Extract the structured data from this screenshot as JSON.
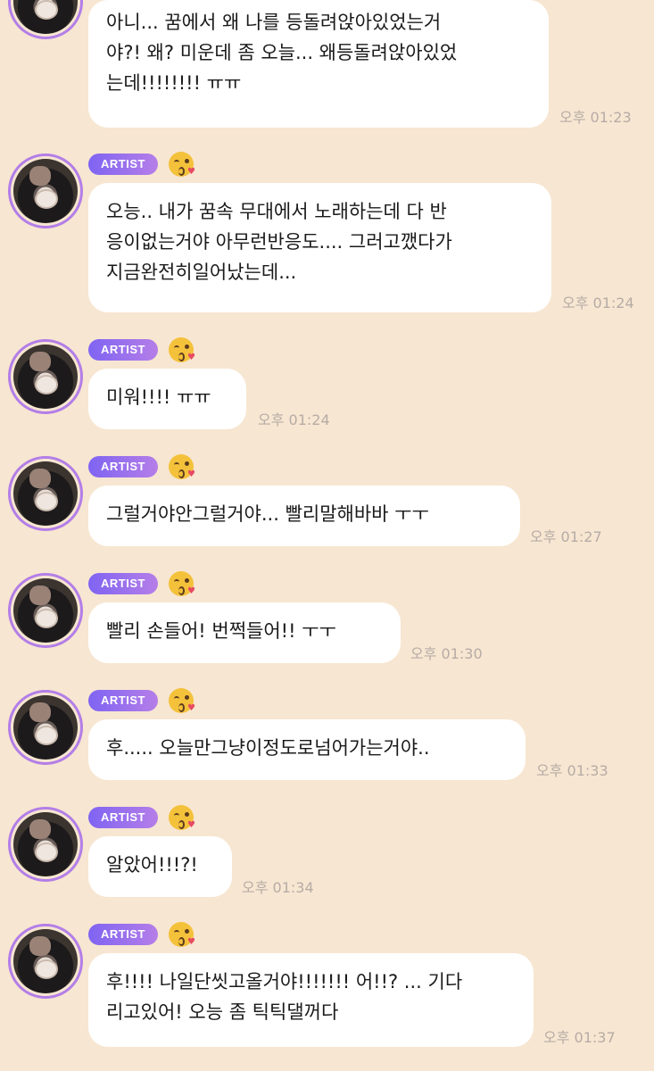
{
  "chat": {
    "messages": [
      {
        "show_header": false,
        "text": "아니... 꿈에서 왜 나를 등돌려앉아있었는거\n야?! 왜? 미운데 좀 오늘... 왜등돌려앉아있었\n는데!!!!!!!! ㅠㅠ",
        "time": "오후 01:23"
      },
      {
        "show_header": true,
        "badge": "ARTIST",
        "emoji": "kissing-heart-emoji",
        "text": "오능.. 내가 꿈속 무대에서 노래하는데 다 반\n응이없는거야 아무런반응도.... 그러고깼다가\n지금완전히일어났는데...",
        "time": "오후 01:24"
      },
      {
        "show_header": true,
        "badge": "ARTIST",
        "emoji": "kissing-heart-emoji",
        "text": "미워!!!! ㅠㅠ",
        "time": "오후 01:24"
      },
      {
        "show_header": true,
        "badge": "ARTIST",
        "emoji": "kissing-heart-emoji",
        "text": "그럴거야안그럴거야... 빨리말해바바 ㅜㅜ",
        "time": "오후 01:27"
      },
      {
        "show_header": true,
        "badge": "ARTIST",
        "emoji": "kissing-heart-emoji",
        "text": "빨리 손들어! 번쩍들어!! ㅜㅜ",
        "time": "오후 01:30"
      },
      {
        "show_header": true,
        "badge": "ARTIST",
        "emoji": "kissing-heart-emoji",
        "text": "후..... 오늘만그냥이정도로넘어가는거야..",
        "time": "오후 01:33"
      },
      {
        "show_header": true,
        "badge": "ARTIST",
        "emoji": "kissing-heart-emoji",
        "text": "알았어!!!?!",
        "time": "오후 01:34"
      },
      {
        "show_header": true,
        "badge": "ARTIST",
        "emoji": "kissing-heart-emoji",
        "text": "후!!!! 나일단씻고올거야!!!!!!! 어!!? ... 기다\n리고있어! 오능 좀 틱틱댈꺼다",
        "time": "오후 01:37"
      }
    ]
  }
}
